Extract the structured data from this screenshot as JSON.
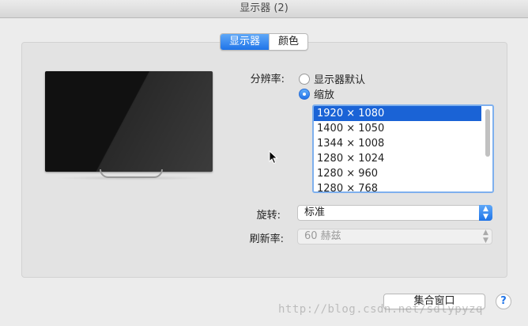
{
  "window": {
    "title": "显示器 (2)"
  },
  "tabs": [
    {
      "label": "显示器",
      "active": true
    },
    {
      "label": "颜色",
      "active": false
    }
  ],
  "resolution": {
    "label": "分辨率:",
    "options": [
      {
        "label": "显示器默认",
        "selected": false
      },
      {
        "label": "缩放",
        "selected": true
      }
    ],
    "list": [
      "1920 × 1080",
      "1400 × 1050",
      "1344 × 1008",
      "1280 × 1024",
      "1280 × 960",
      "1280 × 768"
    ],
    "selected_index": 0
  },
  "rotation": {
    "label": "旋转:",
    "value": "标准"
  },
  "refresh": {
    "label": "刷新率:",
    "value": "60 赫兹",
    "disabled": true
  },
  "footer": {
    "gather_windows": "集合窗口",
    "help": "?"
  },
  "watermark": "http://blog.csdn.net/sdlypyzq",
  "colors": {
    "accent": "#1f74e8",
    "list_selected": "#1a63d6"
  }
}
